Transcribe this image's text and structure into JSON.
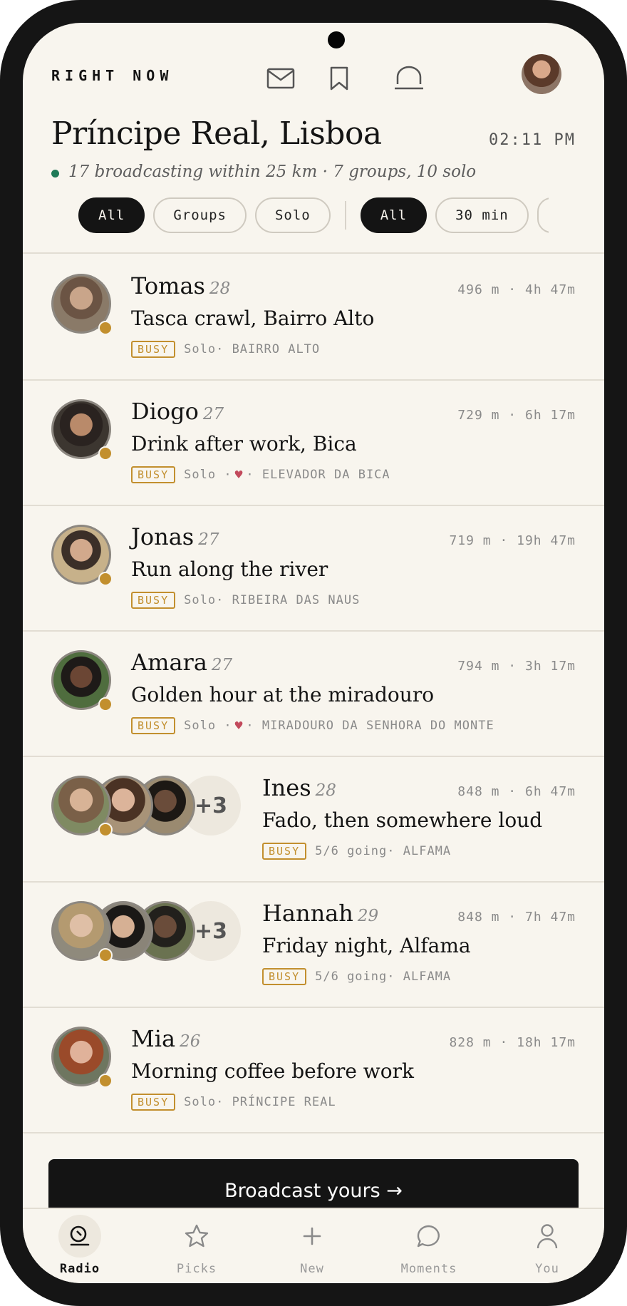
{
  "header": {
    "label": "RIGHT NOW"
  },
  "location": {
    "title": "Príncipe Real, Lisboa",
    "time": "02:11 PM",
    "subtitle": "17 broadcasting within 25 km · 7 groups, 10 solo"
  },
  "filters": {
    "type": [
      "All",
      "Groups",
      "Solo"
    ],
    "time": [
      "All",
      "30 min"
    ]
  },
  "feed": [
    {
      "name": "Tomas",
      "age": "28",
      "distance": "496 m · 4h 47m",
      "activity": "Tasca crawl, Bairro Alto",
      "badge": "BUSY",
      "mode": "Solo",
      "place": "BAIRRO ALTO",
      "heart": false
    },
    {
      "name": "Diogo",
      "age": "27",
      "distance": "729 m · 6h 17m",
      "activity": "Drink after work, Bica",
      "badge": "BUSY",
      "mode": "Solo",
      "place": "ELEVADOR DA BICA",
      "heart": true
    },
    {
      "name": "Jonas",
      "age": "27",
      "distance": "719 m · 19h 47m",
      "activity": "Run along the river",
      "badge": "BUSY",
      "mode": "Solo",
      "place": "RIBEIRA DAS NAUS",
      "heart": false
    },
    {
      "name": "Amara",
      "age": "27",
      "distance": "794 m · 3h 17m",
      "activity": "Golden hour at the miradouro",
      "badge": "BUSY",
      "mode": "Solo",
      "place": "MIRADOURO DA SENHORA DO MONTE",
      "heart": true
    },
    {
      "name": "Ines",
      "age": "28",
      "distance": "848 m · 6h 47m",
      "activity": "Fado, then somewhere loud",
      "badge": "BUSY",
      "mode": "5/6 going",
      "place": "ALFAMA",
      "more": "+3"
    },
    {
      "name": "Hannah",
      "age": "29",
      "distance": "848 m · 7h 47m",
      "activity": "Friday night, Alfama",
      "badge": "BUSY",
      "mode": "5/6 going",
      "place": "ALFAMA",
      "more": "+3"
    },
    {
      "name": "Mia",
      "age": "26",
      "distance": "828 m · 18h 17m",
      "activity": "Morning coffee before work",
      "badge": "BUSY",
      "mode": "Solo",
      "place": "PRÍNCIPE REAL",
      "heart": false
    }
  ],
  "cta": {
    "label": "Broadcast yours →"
  },
  "tabs": [
    "Radio",
    "Picks",
    "New",
    "Moments",
    "You"
  ],
  "colors": {
    "background": "#f8f5ee",
    "ink": "#141414",
    "busy": "#c28f2e",
    "live": "#1f7a57",
    "heart": "#c24a5c"
  }
}
